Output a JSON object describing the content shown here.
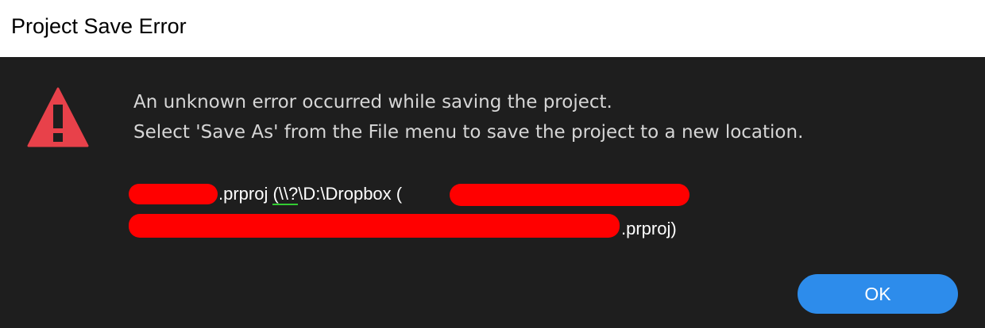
{
  "window": {
    "title": "Project Save Error"
  },
  "dialog": {
    "icon": "warning-triangle-icon",
    "message_line_1": "An unknown error occurred while saving the project.",
    "message_line_2": "Select 'Save As' from the File menu to save the project to a new location.",
    "path_line_1": {
      "ext": ".prproj ",
      "prefix": "(\\\\?",
      "path": "\\D:\\Dropbox ("
    },
    "path_line_2": {
      "end": ".prproj)"
    },
    "ok_label": "OK"
  },
  "colors": {
    "background": "#1e1e1e",
    "titlebar": "#ffffff",
    "text": "#d6d6d6",
    "warning": "#e8414a",
    "button": "#2d8ceb",
    "redaction": "#ff0000"
  }
}
